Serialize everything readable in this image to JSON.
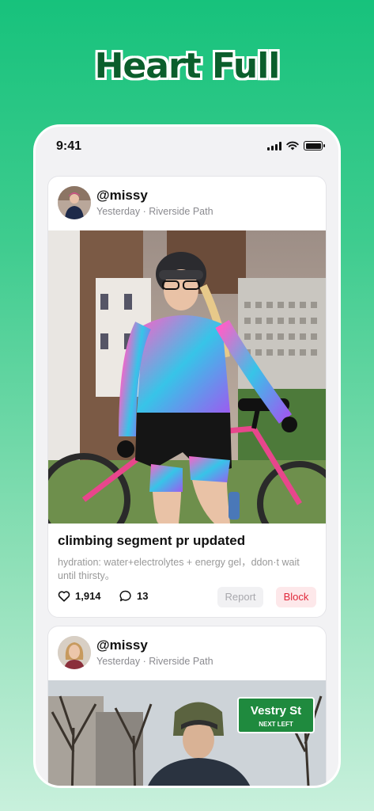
{
  "app": {
    "title": "Heart Full"
  },
  "status_bar": {
    "time": "9:41"
  },
  "posts": [
    {
      "username": "@missy",
      "meta": "Yesterday · Riverside Path",
      "title": "climbing segment pr updated",
      "body": "hydration: water+electrolytes + energy gel，ddon·t wait until thirsty。",
      "likes": "1,914",
      "comments": "13",
      "report_label": "Report",
      "block_label": "Block"
    },
    {
      "username": "@missy",
      "meta": "Yesterday · Riverside Path",
      "sign_text_1": "Vestry St",
      "sign_text_2": "NEXT LEFT"
    }
  ],
  "colors": {
    "accent": "#17c27c",
    "title_text": "#0b5e2c",
    "block_text": "#e0283a",
    "block_bg": "#fde8ea"
  }
}
